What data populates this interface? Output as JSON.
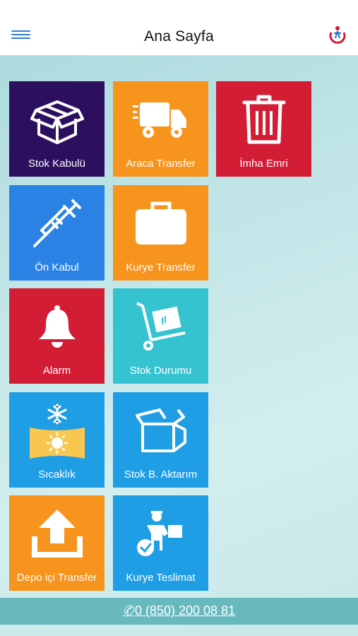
{
  "header": {
    "title": "Ana Sayfa"
  },
  "tiles": [
    {
      "label": "Stok Kabulü",
      "color": "#2c0f5e",
      "icon": "box-icon"
    },
    {
      "label": "Araca Transfer",
      "color": "#f7941d",
      "icon": "truck-icon"
    },
    {
      "label": "İmha Emri",
      "color": "#d21d35",
      "icon": "trash-icon"
    },
    {
      "label": "Ön Kabul",
      "color": "#2a82e4",
      "icon": "syringe-icon"
    },
    {
      "label": "Kurye Transfer",
      "color": "#f7941d",
      "icon": "briefcase-icon"
    },
    {
      "label": "Alarm",
      "color": "#d21d35",
      "icon": "bell-icon"
    },
    {
      "label": "Stok Durumu",
      "color": "#35c3d1",
      "icon": "hand-truck-icon"
    },
    {
      "label": "Sıcaklık",
      "color": "#1f9ee6",
      "icon": "temperature-icon"
    },
    {
      "label": "Stok B. Aktarım",
      "color": "#1f9ee6",
      "icon": "open-box-icon"
    },
    {
      "label": "Depo içi Transfer",
      "color": "#f7941d",
      "icon": "upload-icon"
    },
    {
      "label": "Kurye Teslimat",
      "color": "#1f9ee6",
      "icon": "courier-icon"
    }
  ],
  "footer": {
    "phone_icon": "✆",
    "phone": "0 (850) 200 08 81"
  }
}
